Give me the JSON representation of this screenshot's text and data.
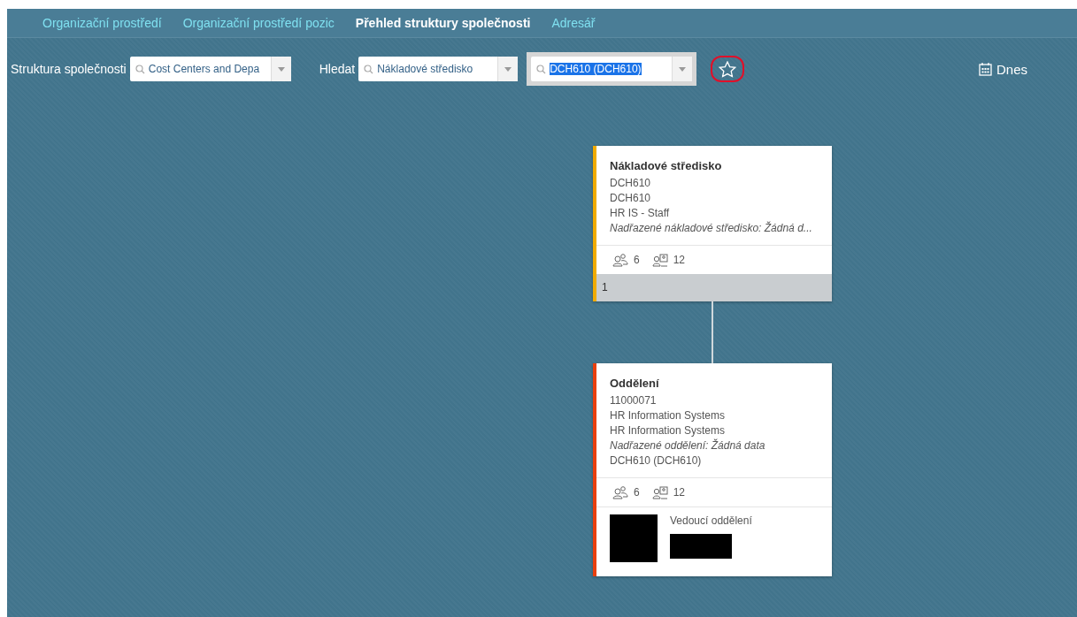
{
  "tabs": [
    {
      "label": "Organizační prostředí",
      "selected": false
    },
    {
      "label": "Organizační prostředí pozic",
      "selected": false
    },
    {
      "label": "Přehled struktury společnosti",
      "selected": true
    },
    {
      "label": "Adresář",
      "selected": false
    }
  ],
  "toolbar": {
    "structure_label": "Struktura společnosti",
    "structure_value": "Cost Centers and Depa",
    "search_label": "Hledat",
    "search_type": "Nákladové středisko",
    "search_value": "DCH610 (DCH610)",
    "search_value_selected": true,
    "favorite_circled": true,
    "date_button": "Dnes"
  },
  "nodes": [
    {
      "title": "Nákladové středisko",
      "color": "#f0ab00",
      "lines": [
        {
          "text": "DCH610",
          "italic": false
        },
        {
          "text": "DCH610",
          "italic": false
        },
        {
          "text": "HR IS - Staff",
          "italic": false
        },
        {
          "text": "Nadřazené nákladové středisko: Žádná d...",
          "italic": true
        }
      ],
      "employees": "6",
      "positions": "12",
      "footer": "1"
    },
    {
      "title": "Oddělení",
      "color": "#e9400e",
      "lines": [
        {
          "text": "11000071",
          "italic": false
        },
        {
          "text": "HR Information Systems",
          "italic": false
        },
        {
          "text": "HR Information Systems",
          "italic": false
        },
        {
          "text": "Nadřazené oddělení: Žádná data",
          "italic": true
        },
        {
          "text": "DCH610 (DCH610)",
          "italic": false
        }
      ],
      "employees": "6",
      "positions": "12",
      "manager": {
        "label": "Vedoucí oddělení",
        "redacted": true
      }
    }
  ]
}
